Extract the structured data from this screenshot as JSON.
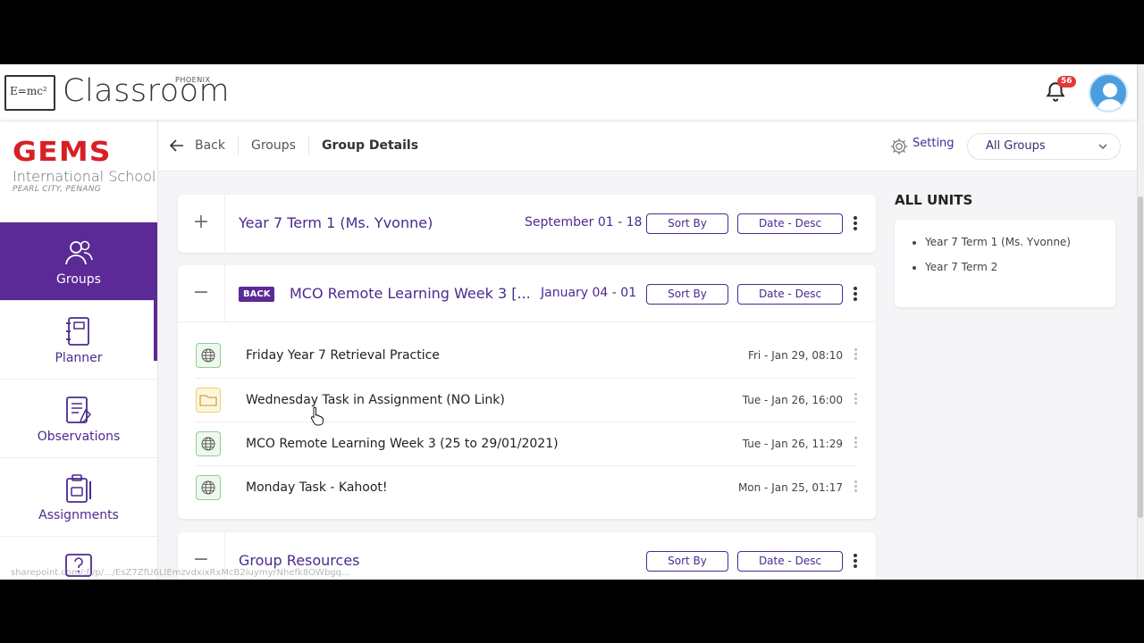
{
  "app": {
    "logo_equation": "E=mc²",
    "logo_text": "Classroom",
    "logo_sub": "PHOENIX",
    "notification_count": "56"
  },
  "school": {
    "name_top": "GEMS",
    "name_mid": "International School",
    "location": "PEARL CITY, PENANG"
  },
  "sidebar": {
    "items": [
      {
        "label": "Groups",
        "icon": "users-icon",
        "active": true
      },
      {
        "label": "Planner",
        "icon": "planner-icon"
      },
      {
        "label": "Observations",
        "icon": "observations-icon"
      },
      {
        "label": "Assignments",
        "icon": "assignments-icon"
      }
    ]
  },
  "breadcrumb": {
    "back": "Back",
    "groups": "Groups",
    "current": "Group Details"
  },
  "header_controls": {
    "setting": "Setting",
    "group_select": "All Groups"
  },
  "units": [
    {
      "title": "Year 7 Term 1 (Ms. Yvonne)",
      "date": "September 01 - 18",
      "toggle": "+",
      "sort_by": "Sort By",
      "sort_order": "Date - Desc"
    },
    {
      "badge": "BACK",
      "title": "MCO Remote Learning Week 3 [...",
      "date": "January 04 - 01",
      "toggle": "−",
      "sort_by": "Sort By",
      "sort_order": "Date - Desc",
      "rows": [
        {
          "title": "Friday Year 7 Retrieval Practice",
          "date": "Fri - Jan 29, 08:10",
          "type": "web"
        },
        {
          "title": "Wednesday Task in Assignment (NO Link)",
          "date": "Tue - Jan 26, 16:00",
          "type": "folder"
        },
        {
          "title": "MCO Remote Learning Week 3 (25 to 29/01/2021)",
          "date": "Tue - Jan 26, 11:29",
          "type": "web"
        },
        {
          "title": "Monday Task - Kahoot!",
          "date": "Mon - Jan 25, 01:17",
          "type": "web"
        }
      ]
    },
    {
      "title": "Group Resources",
      "toggle": "−",
      "sort_by": "Sort By",
      "sort_order": "Date - Desc"
    }
  ],
  "all_units": {
    "title": "ALL UNITS",
    "items": [
      "Year 7 Term 1 (Ms. Yvonne)",
      "Year 7 Term 2"
    ]
  },
  "status_url": "sharepoint.com/:f:/p/.../EsZ7ZfU6LIEmzvdxixRxMcB2iuymyrNhefk8OWbgq..."
}
